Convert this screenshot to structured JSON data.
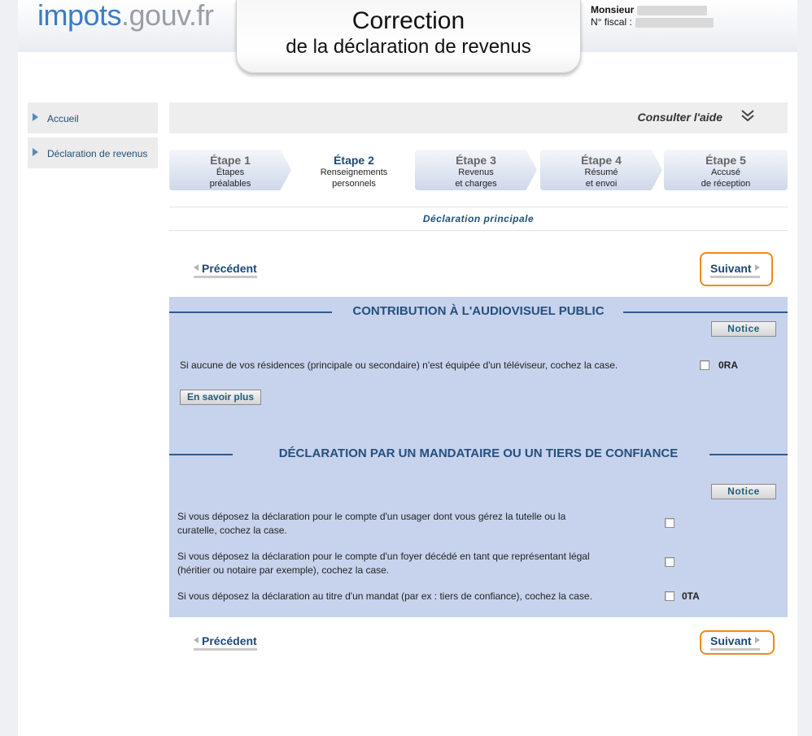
{
  "header": {
    "logo_part1": "impots",
    "logo_part2": ".gouv.fr",
    "title_line1": "Correction",
    "title_line2": "de la déclaration de revenus",
    "user_label": "Monsieur",
    "fiscal_label": "N° fiscal :"
  },
  "sidebar": {
    "items": [
      {
        "label": "Accueil"
      },
      {
        "label": "Déclaration de revenus"
      }
    ]
  },
  "help": {
    "label": "Consulter l'aide"
  },
  "steps": [
    {
      "title": "Étape 1",
      "line1": "Étapes",
      "line2": "préalables"
    },
    {
      "title": "Étape 2",
      "line1": "Renseignements",
      "line2": "personnels"
    },
    {
      "title": "Étape 3",
      "line1": "Revenus",
      "line2": "et charges"
    },
    {
      "title": "Étape 4",
      "line1": "Résumé",
      "line2": "et envoi"
    },
    {
      "title": "Étape 5",
      "line1": "Accusé",
      "line2": "de réception"
    }
  ],
  "subtitle": "Déclaration principale",
  "nav": {
    "prev_label": "Précédent",
    "next_label": "Suivant"
  },
  "section_audiovisuel": {
    "title": "CONTRIBUTION À L'AUDIOVISUEL PUBLIC",
    "notice_label": "Notice",
    "question": "Si aucune de vos résidences (principale ou secondaire) n'est équipée d'un téléviseur, cochez la case.",
    "code": "0RA",
    "more_label": "En savoir plus"
  },
  "section_mandataire": {
    "title": "DÉCLARATION PAR UN MANDATAIRE OU UN TIERS DE CONFIANCE",
    "notice_label": "Notice",
    "q1_line1": "Si vous déposez la déclaration pour le compte d'un usager dont vous gérez la tutelle ou la",
    "q1_line2": "curatelle, cochez la case.",
    "q2_line1": "Si vous déposez la déclaration pour le compte d'un foyer décédé en tant que représentant légal",
    "q2_line2": "(héritier ou notaire par exemple), cochez la case.",
    "q3": "Si vous déposez la déclaration au titre d'un mandat (par ex : tiers de confiance), cochez la case.",
    "q3_code": "0TA"
  }
}
